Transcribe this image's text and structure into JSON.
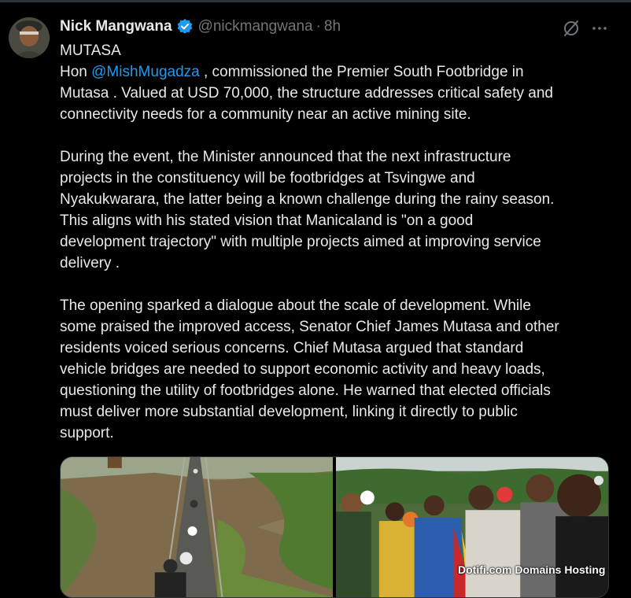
{
  "user": {
    "display_name": "Nick Mangwana",
    "handle": "@nickmangwana",
    "separator": "·",
    "time": "8h"
  },
  "icons": {
    "verified": "verified-badge-icon",
    "grok": "grok-slash-icon",
    "more": "more-horizontal-icon",
    "avatar": "avatar"
  },
  "colors": {
    "background": "#000000",
    "text": "#e7e9ea",
    "secondary_text": "#71767b",
    "accent": "#1d9bf0"
  },
  "tweet": {
    "line1": "MUTASA",
    "p1": {
      "prefix": "Hon ",
      "mention": "@MishMugadza",
      "line1_rest": " , commissioned the Premier South Footbridge in",
      "line2": "Mutasa . Valued at USD 70,000, the structure addresses critical safety and",
      "line3": "connectivity needs for a community near an active mining site."
    },
    "p2": [
      "During the event, the Minister announced that the next infrastructure",
      "projects in the constituency will be footbridges at Tsvingwe and",
      "Nyakukwarara, the latter being a known challenge during the rainy season.",
      "This aligns with his stated vision that Manicaland is \"on a good",
      "development trajectory\" with multiple projects aimed at improving service",
      "delivery ."
    ],
    "p3": [
      "The opening sparked a dialogue about the scale of development. While",
      "some praised the improved access, Senator Chief James Mutasa and other",
      "residents voiced serious concerns. Chief Mutasa argued that standard",
      "vehicle bridges are needed to support economic activity and heavy loads,",
      "questioning the utility of footbridges alone. He warned that elected officials",
      "must deliver more substantial development, linking it directly to public",
      "support."
    ]
  },
  "watermark": "Dotifi.com Domains Hosting"
}
